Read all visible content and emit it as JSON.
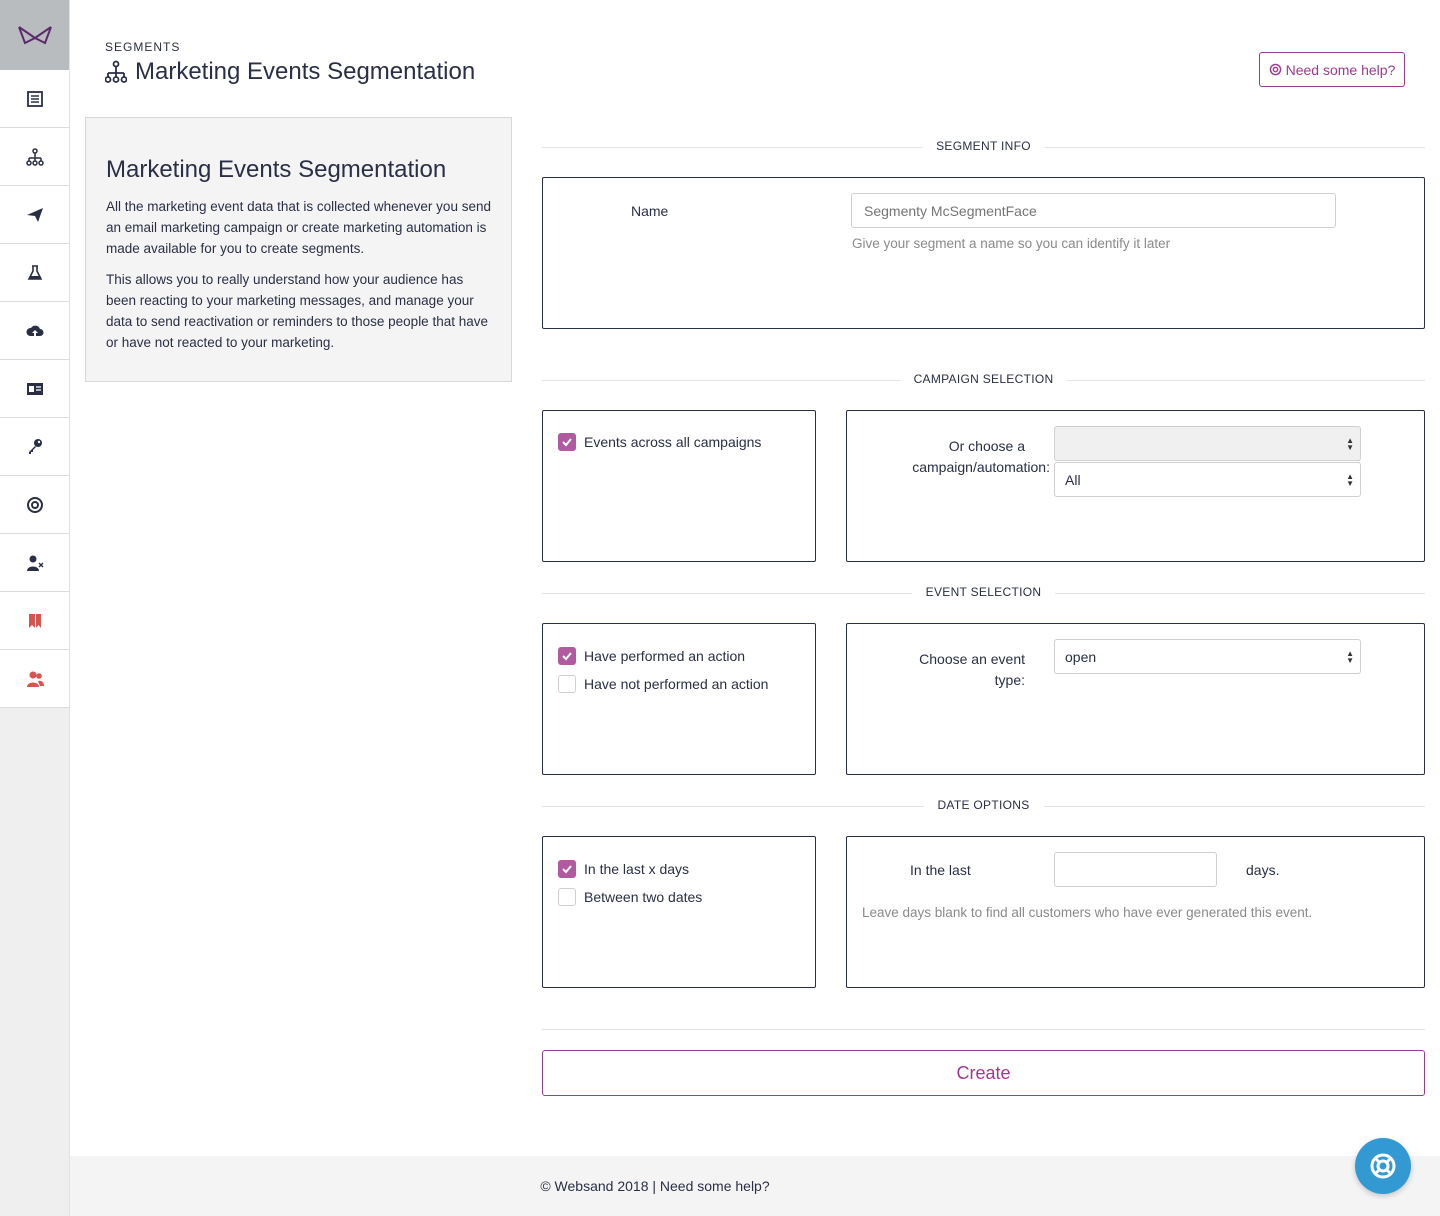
{
  "header": {
    "breadcrumb": "SEGMENTS",
    "title": "Marketing Events Segmentation",
    "help_button": "Need some help?"
  },
  "sidebar": {
    "items": [
      {
        "icon": "list-icon"
      },
      {
        "icon": "segments-icon"
      },
      {
        "icon": "send-icon"
      },
      {
        "icon": "flask-icon"
      },
      {
        "icon": "cloud-upload-icon"
      },
      {
        "icon": "id-card-icon"
      },
      {
        "icon": "key-icon"
      },
      {
        "icon": "lifebuoy-icon"
      },
      {
        "icon": "user-remove-icon"
      },
      {
        "icon": "bookmarks-icon",
        "color": "#d9534f"
      },
      {
        "icon": "users-icon",
        "color": "#d9534f"
      }
    ]
  },
  "info": {
    "heading": "Marketing Events Segmentation",
    "para1": "All the marketing event data that is collected whenever you send an email marketing campaign or create marketing automation is made available for you to create segments.",
    "para2": "This allows you to really understand how your audience has been reacting to your marketing messages, and manage your data to send reactivation or reminders to those people that have or have not reacted to your marketing."
  },
  "segment_info": {
    "section": "SEGMENT INFO",
    "name_label": "Name",
    "name_placeholder": "Segmenty McSegmentFace",
    "name_value": "",
    "name_help": "Give your segment a name so you can identify it later"
  },
  "campaign_selection": {
    "section": "CAMPAIGN SELECTION",
    "all_campaigns_label": "Events across all campaigns",
    "all_campaigns_checked": true,
    "choose_label_1": "Or choose a",
    "choose_label_2": "campaign/automation:",
    "campaign_select_value": "",
    "automation_select_value": "All"
  },
  "event_selection": {
    "section": "EVENT SELECTION",
    "performed_label": "Have performed an action",
    "performed_checked": true,
    "not_performed_label": "Have not performed an action",
    "not_performed_checked": false,
    "event_type_label_1": "Choose an event",
    "event_type_label_2": "type:",
    "event_type_value": "open"
  },
  "date_options": {
    "section": "DATE OPTIONS",
    "last_x_days_label": "In the last x days",
    "last_x_days_checked": true,
    "between_dates_label": "Between two dates",
    "between_dates_checked": false,
    "in_the_last_label": "In the last",
    "days_value": "",
    "days_suffix": "days.",
    "days_help": "Leave days blank to find all customers who have ever generated this event."
  },
  "actions": {
    "create_label": "Create"
  },
  "footer": {
    "copyright": "© Websand 2018 | Need some help?"
  },
  "colors": {
    "brand": "#a0388f",
    "checkbox": "#b05aa1",
    "fab": "#3399d3",
    "text": "#2a2f45"
  }
}
